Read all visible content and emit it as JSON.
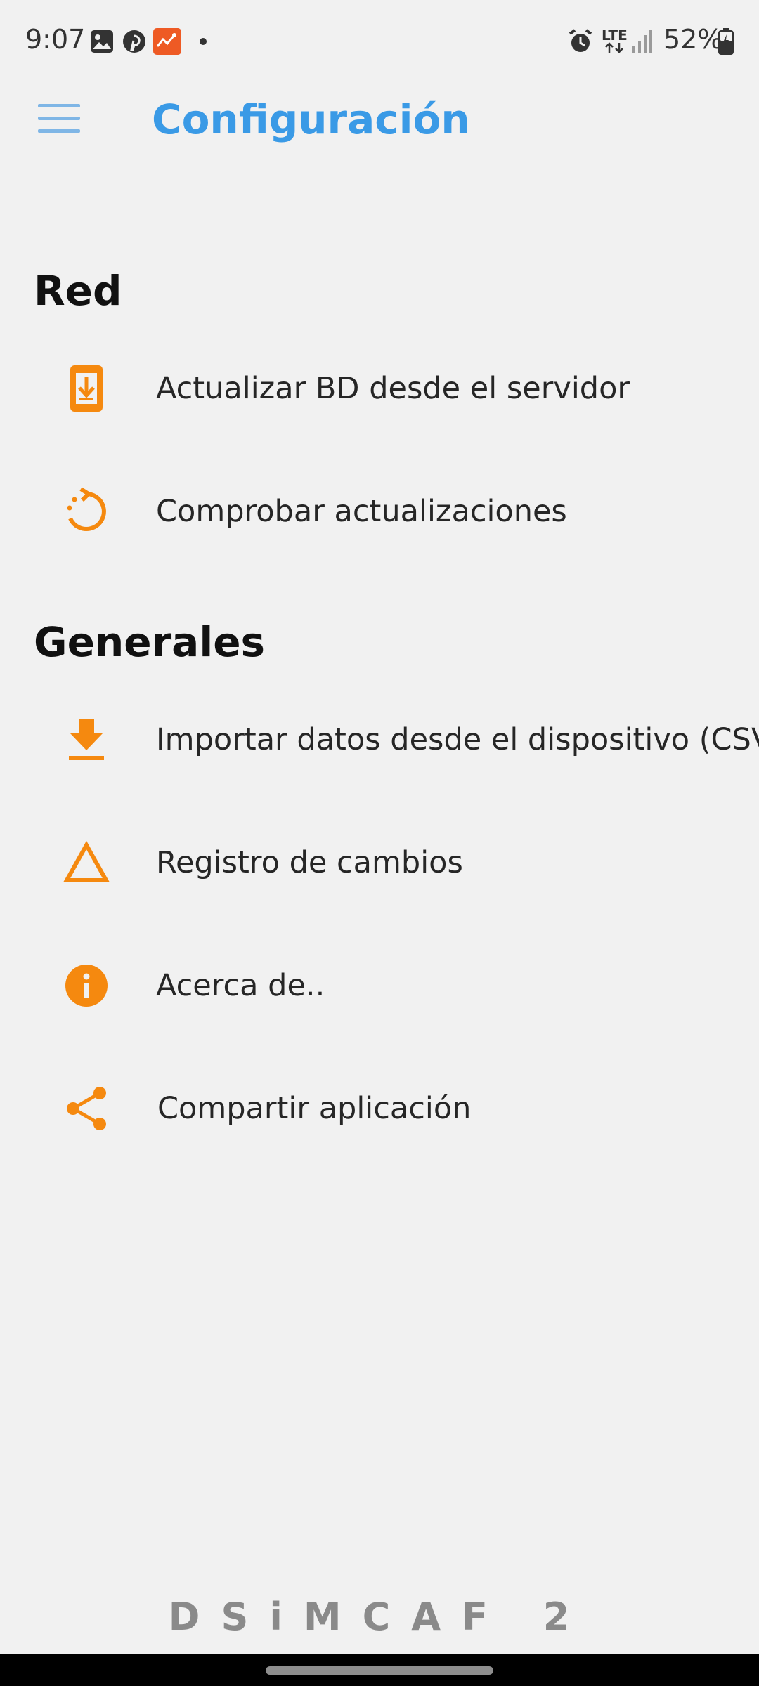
{
  "status_bar": {
    "time": "9:07",
    "network": "LTE",
    "battery": "52%"
  },
  "app_bar": {
    "title": "Configuración",
    "accent_color": "#3a9ae6"
  },
  "sections": [
    {
      "header": "Red",
      "items": [
        {
          "label": "Actualizar BD desde el servidor",
          "icon": "phone-download-icon"
        },
        {
          "label": "Comprobar actualizaciones",
          "icon": "refresh-icon"
        }
      ]
    },
    {
      "header": "Generales",
      "items": [
        {
          "label": "Importar datos desde el dispositivo (CSV)",
          "icon": "download-icon"
        },
        {
          "label": "Registro de cambios",
          "icon": "delta-icon"
        },
        {
          "label": "Acerca de..",
          "icon": "info-icon"
        },
        {
          "label": "Compartir aplicación",
          "icon": "share-icon"
        }
      ]
    }
  ],
  "icon_color": "#f5890f",
  "footer": {
    "brand": "DSiMCAF 2"
  }
}
